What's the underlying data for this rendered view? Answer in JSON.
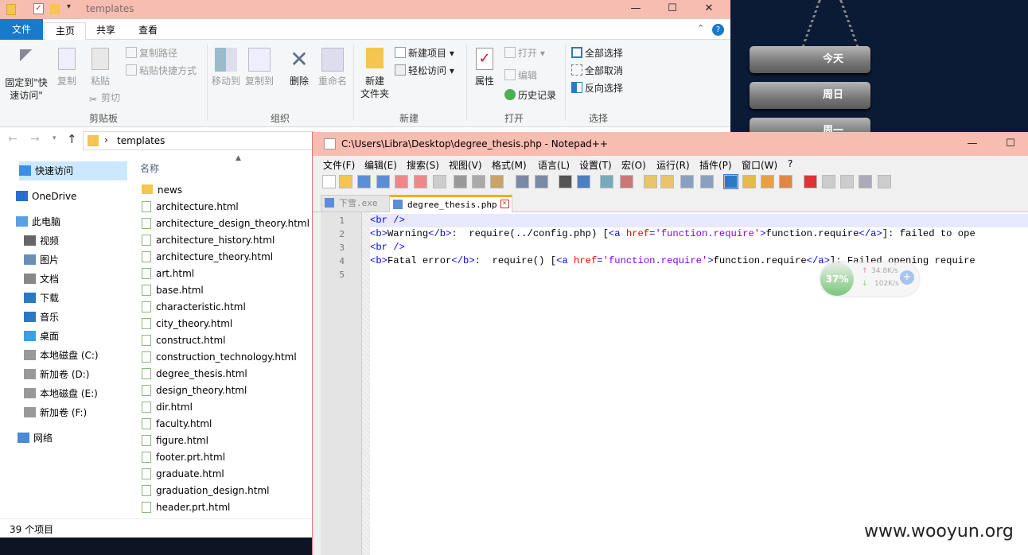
{
  "explorer": {
    "title": "templates",
    "window_buttons": [
      "—",
      "☐",
      "✕"
    ],
    "tabs": [
      "文件",
      "主页",
      "共享",
      "查看"
    ],
    "ribbon": {
      "pin": "固定到\"快\n速访问\"",
      "copy": "复制",
      "paste": "粘贴",
      "copy_path": "复制路径",
      "paste_shortcut": "粘贴快捷方式",
      "cut": "剪切",
      "group_clipboard": "剪贴板",
      "move_to": "移动到",
      "copy_to": "复制到",
      "delete": "删除",
      "rename": "重命名",
      "group_organize": "组织",
      "new_folder": "新建\n文件夹",
      "new_item": "新建项目",
      "easy_access": "轻松访问",
      "group_new": "新建",
      "properties": "属性",
      "open": "打开",
      "edit": "编辑",
      "history": "历史记录",
      "group_open": "打开",
      "select_all": "全部选择",
      "select_none": "全部取消",
      "invert_selection": "反向选择",
      "group_select": "选择"
    },
    "address": {
      "path": "templates",
      "separator": "›"
    },
    "column_header": "名称",
    "nav": [
      {
        "label": "快速访问",
        "icon": "star-icon"
      },
      {
        "label": "OneDrive",
        "icon": "cloud-icon"
      },
      {
        "label": "此电脑",
        "icon": "computer-icon"
      },
      {
        "label": "视频",
        "icon": "video-icon"
      },
      {
        "label": "图片",
        "icon": "picture-icon"
      },
      {
        "label": "文档",
        "icon": "document-icon"
      },
      {
        "label": "下载",
        "icon": "download-icon"
      },
      {
        "label": "音乐",
        "icon": "music-icon"
      },
      {
        "label": "桌面",
        "icon": "desktop-icon"
      },
      {
        "label": "本地磁盘 (C:)",
        "icon": "drive-icon"
      },
      {
        "label": "新加卷 (D:)",
        "icon": "drive-icon"
      },
      {
        "label": "本地磁盘 (E:)",
        "icon": "drive-icon"
      },
      {
        "label": "新加卷 (F:)",
        "icon": "drive-icon"
      },
      {
        "label": "网络",
        "icon": "network-icon"
      }
    ],
    "files": [
      "news",
      "architecture.html",
      "architecture_design_theory.html",
      "architecture_history.html",
      "architecture_theory.html",
      "art.html",
      "base.html",
      "characteristic.html",
      "city_theory.html",
      "construct.html",
      "construction_technology.html",
      "degree_thesis.html",
      "design_theory.html",
      "dir.html",
      "faculty.html",
      "figure.html",
      "footer.prt.html",
      "graduate.html",
      "graduation_design.html",
      "header.prt.html"
    ],
    "status": "39 个项目"
  },
  "desktop": {
    "planks": [
      "今天",
      "周日",
      "周一"
    ]
  },
  "notepad": {
    "title": "C:\\Users\\Libra\\Desktop\\degree_thesis.php - Notepad++",
    "window_buttons": [
      "—",
      "☐"
    ],
    "menu": [
      "文件(F)",
      "编辑(E)",
      "搜索(S)",
      "视图(V)",
      "格式(M)",
      "语言(L)",
      "设置(T)",
      "宏(O)",
      "运行(R)",
      "插件(P)",
      "窗口(W)",
      "?"
    ],
    "tabs": [
      {
        "label": "下雪.exe",
        "active": false
      },
      {
        "label": "degree_thesis.php",
        "active": true
      }
    ],
    "line_numbers": [
      "1",
      "2",
      "3",
      "4",
      "5"
    ],
    "code": {
      "l1_tag": "<br />",
      "l2_open": "<b>",
      "l2_bold": "Warning",
      "l2_close": "</b>",
      "l2_text": ":  require(../config.php) [",
      "l2_a_open": "<a ",
      "l2_attr": "href",
      "l2_eq": "=",
      "l2_val": "'function.require'",
      "l2_gt": ">",
      "l2_link": "function.require",
      "l2_a_close": "</a>",
      "l2_tail": "]: failed to ope",
      "l3_tag": "<br />",
      "l4_open": "<b>",
      "l4_bold": "Fatal error",
      "l4_close": "</b>",
      "l4_text": ":  require() [",
      "l4_a_open": "<a ",
      "l4_attr": "href",
      "l4_eq": "=",
      "l4_val": "'function.require'",
      "l4_gt": ">",
      "l4_link": "function.require",
      "l4_a_close": "</a>",
      "l4_tail": "]: Failed opening require"
    }
  },
  "net_widget": {
    "percent": "37%",
    "up": "34.8K/s",
    "down": "102K/s"
  },
  "watermark": "www.wooyun.org"
}
